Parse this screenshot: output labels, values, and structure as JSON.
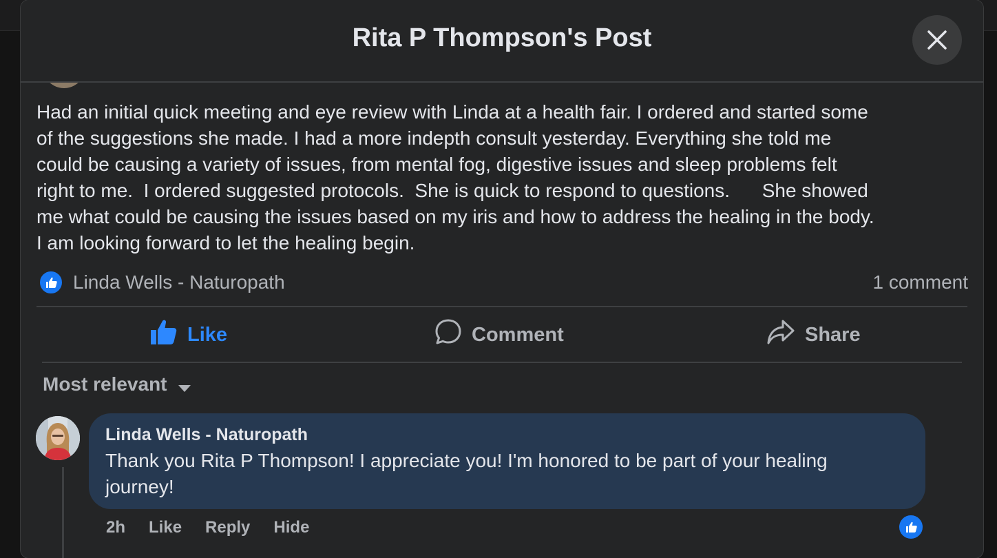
{
  "window": {
    "title": "Rita P Thompson's Post"
  },
  "post": {
    "lines": [
      "Had an initial quick meeting and eye review with Linda at a health fair.  I ordered and started some",
      "of the suggestions she made.  I had a more indepth consult yesterday.  Everything she told me",
      "could be causing a variety of issues, from mental fog, digestive issues and sleep problems felt",
      "right to me.  I ordered suggested protocols.  She is quick to respond to questions.      She showed",
      "me what could be causing the issues based on my iris and how to address the healing in the body.",
      "I am looking forward to let the healing begin."
    ],
    "reactor_name": "Linda Wells - Naturopath",
    "comment_count": "1 comment"
  },
  "actions": {
    "like": "Like",
    "comment": "Comment",
    "share": "Share"
  },
  "sort": {
    "label": "Most relevant"
  },
  "comment": {
    "author": "Linda Wells - Naturopath",
    "lines": [
      "Thank you Rita P Thompson! I appreciate you! I'm honored to be part of your healing",
      "journey!"
    ],
    "time": "2h",
    "like": "Like",
    "reply": "Reply",
    "hide": "Hide"
  },
  "colors": {
    "accent": "#2d88ff",
    "bubble": "#263951",
    "surface": "#242526"
  },
  "icons": [
    "close-icon",
    "like-badge-icon",
    "thumbs-up-icon",
    "comment-icon",
    "share-icon",
    "caret-down-icon"
  ]
}
